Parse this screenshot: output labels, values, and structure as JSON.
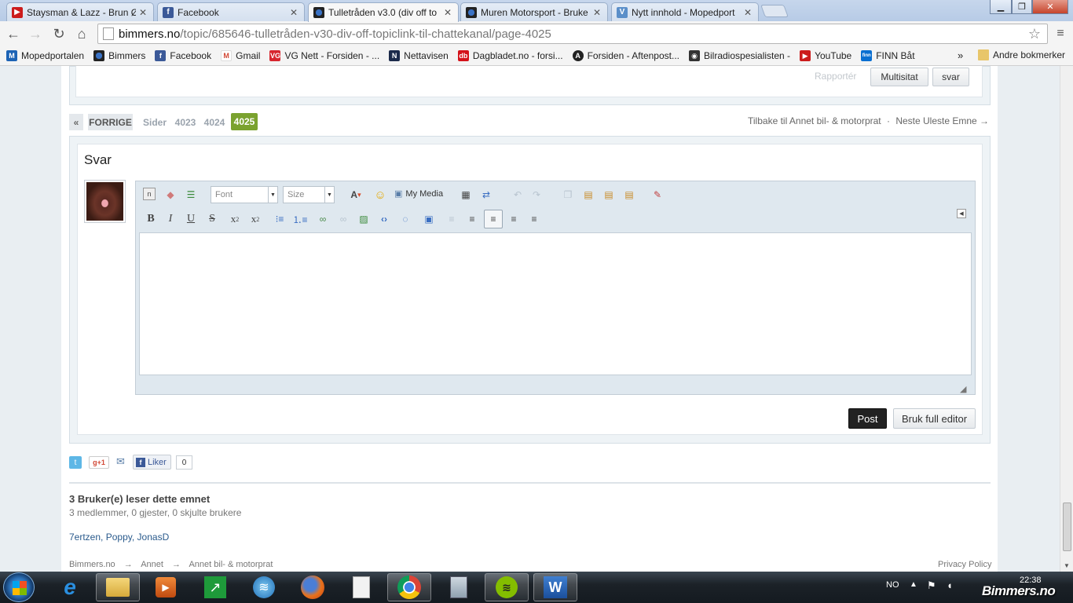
{
  "browser": {
    "tabs": [
      {
        "title": "Staysman & Lazz - Brun Ø",
        "icon": "youtube-icon"
      },
      {
        "title": "Facebook",
        "icon": "facebook-icon"
      },
      {
        "title": "Tulletråden v3.0 (div off to",
        "icon": "bmw-icon",
        "active": true
      },
      {
        "title": "Muren Motorsport - Bruke",
        "icon": "bmw-icon"
      },
      {
        "title": "Nytt innhold - Mopedport",
        "icon": "mopedportalen-icon"
      }
    ],
    "url_host": "bimmers.no",
    "url_path": "/topic/685646-tulletråden-v30-div-off-topiclink-til-chattekanal/page-4025",
    "bookmarks": [
      {
        "label": "Mopedportalen",
        "icon": "mopedportalen-icon"
      },
      {
        "label": "Bimmers",
        "icon": "bmw-icon"
      },
      {
        "label": "Facebook",
        "icon": "facebook-icon"
      },
      {
        "label": "Gmail",
        "icon": "gmail-icon"
      },
      {
        "label": "VG Nett - Forsiden - ...",
        "icon": "vg-icon"
      },
      {
        "label": "Nettavisen",
        "icon": "nettavisen-icon"
      },
      {
        "label": "Dagbladet.no - forsi...",
        "icon": "dagbladet-icon"
      },
      {
        "label": "Forsiden - Aftenpost...",
        "icon": "aftenposten-icon"
      },
      {
        "label": "Bilradiospesialisten -",
        "icon": "bilradio-icon"
      },
      {
        "label": "YouTube",
        "icon": "youtube-icon"
      },
      {
        "label": "FINN Båt",
        "icon": "finn-icon"
      }
    ],
    "bookmarks_overflow": "»",
    "other_bookmarks": "Andre bokmerker"
  },
  "post_actions": {
    "report": "Rapportér",
    "multiquote": "Multisitat",
    "reply": "svar"
  },
  "pagination": {
    "prev_arrow": "«",
    "prev_label": "FORRIGE",
    "pages_label": "Sider",
    "pages": [
      "4023",
      "4024"
    ],
    "current": "4025",
    "back_link": "Tilbake til Annet bil- & motorprat",
    "separator": "·",
    "next_unread": "Neste Uleste Emne →"
  },
  "reply": {
    "title": "Svar",
    "font_placeholder": "Font",
    "size_placeholder": "Size",
    "my_media": "My Media",
    "post_button": "Post",
    "full_editor_button": "Bruk full editor"
  },
  "social": {
    "gplus": "+1",
    "like": "Liker",
    "like_count": "0"
  },
  "readers": {
    "title": "3 Bruker(e) leser dette emnet",
    "summary": "3 medlemmer, 0 gjester, 0 skjulte brukere",
    "users": [
      "7ertzen",
      "Poppy",
      "JonasD"
    ],
    "sep": ","
  },
  "breadcrumb": {
    "items": [
      "Bimmers.no",
      "Annet",
      "Annet bil- & motorprat"
    ],
    "arrow": "→",
    "privacy": "Privacy Policy"
  },
  "taskbar": {
    "language": "NO",
    "time": "22:38",
    "watermark": "Bimmers.no"
  },
  "colors": {
    "accent_green": "#7aa22f",
    "post_button": "#222222",
    "link_blue": "#2a5a8c"
  }
}
